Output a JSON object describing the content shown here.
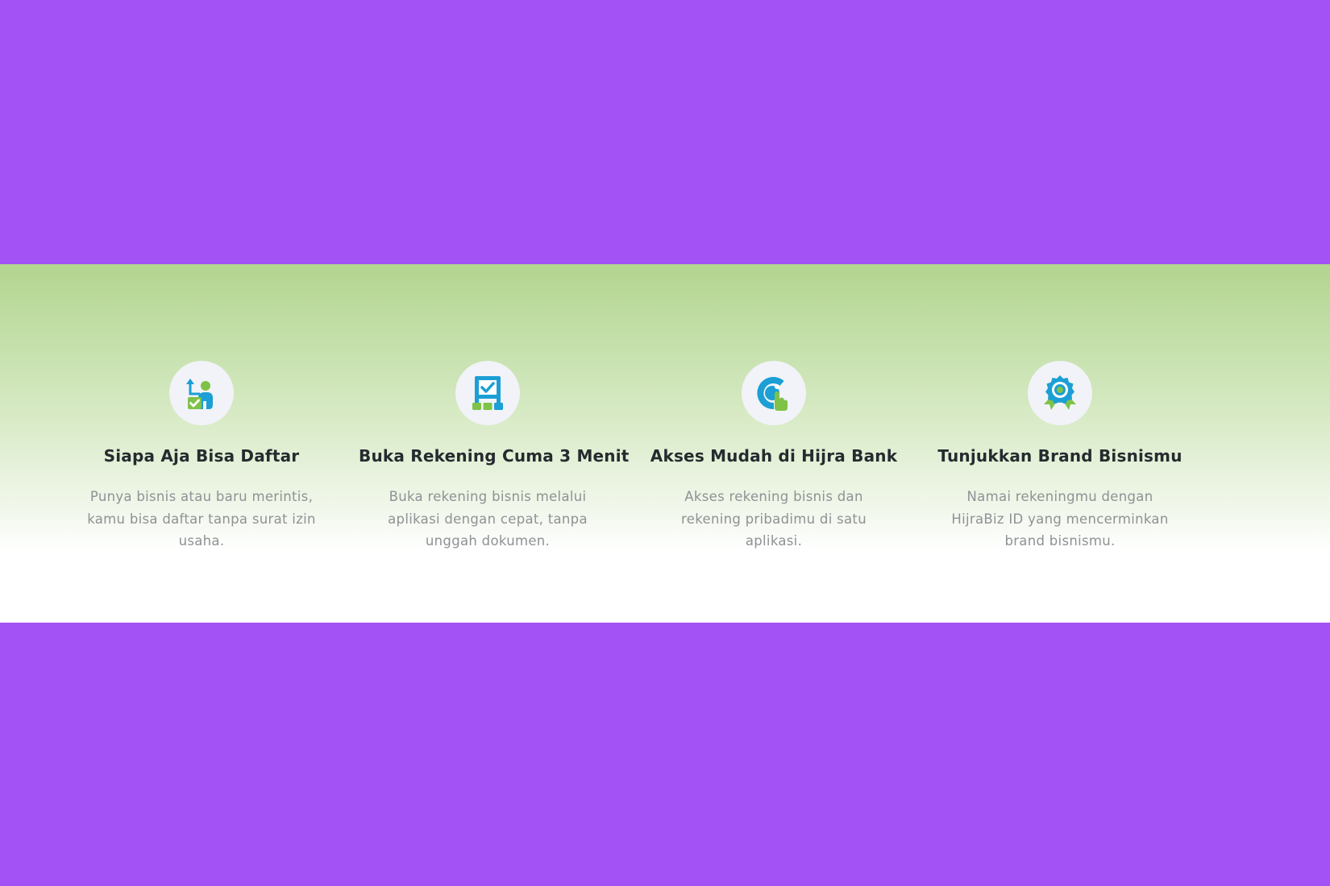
{
  "colors": {
    "background": "#a352f5",
    "band_top": "#b2d58f",
    "band_bottom": "#ffffff",
    "icon_blue": "#1b9fd4",
    "icon_green": "#7fc248",
    "title": "#262b2f",
    "description": "#8e9295"
  },
  "features": [
    {
      "icon": "person-checklist-icon",
      "title": "Siapa Aja Bisa Daftar",
      "description": "Punya bisnis atau baru merintis, kamu bisa daftar tanpa surat izin usaha."
    },
    {
      "icon": "checkbox-board-icon",
      "title": "Buka Rekening Cuma 3 Menit",
      "description": "Buka rekening bisnis melalui aplikasi dengan cepat, tanpa unggah dokumen."
    },
    {
      "icon": "tap-access-icon",
      "title": "Akses Mudah di Hijra Bank",
      "description": "Akses rekening bisnis dan rekening pribadimu di satu aplikasi."
    },
    {
      "icon": "badge-award-icon",
      "title": "Tunjukkan Brand Bisnismu",
      "description": "Namai rekeningmu dengan HijraBiz ID yang mencerminkan brand bisnismu."
    }
  ]
}
